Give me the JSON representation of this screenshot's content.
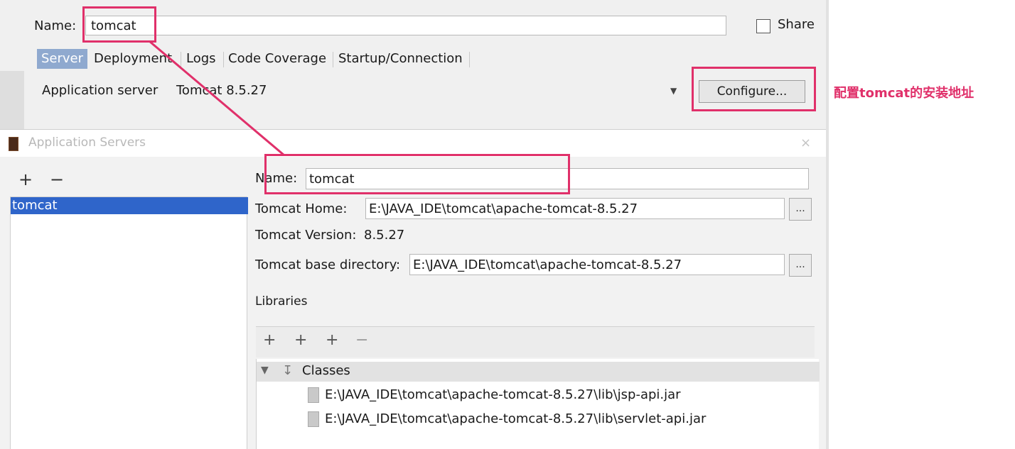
{
  "run_config": {
    "name_label": "Name:",
    "name_value": "tomcat",
    "share_label": "Share",
    "tabs": [
      "Server",
      "Deployment",
      "Logs",
      "Code Coverage",
      "Startup/Connection"
    ],
    "active_tab": "Server",
    "app_server_label": "Application server",
    "app_server_value": "Tomcat 8.5.27",
    "configure_button": "Configure..."
  },
  "annotation": {
    "text": "配置tomcat的安装地址",
    "color": "#e0306a"
  },
  "dialog": {
    "title": "Application Servers",
    "close_label": "×",
    "list_toolbar": {
      "add": "+",
      "remove": "−"
    },
    "servers": [
      "tomcat"
    ],
    "selected_server": "tomcat",
    "name_label": "Name:",
    "name_value": "tomcat",
    "tomcat_home_label": "Tomcat Home:",
    "tomcat_home_value": "E:\\JAVA_IDE\\tomcat\\apache-tomcat-8.5.27",
    "tomcat_version_label": "Tomcat Version:",
    "tomcat_version_value": "8.5.27",
    "base_dir_label": "Tomcat base directory:",
    "base_dir_value": "E:\\JAVA_IDE\\tomcat\\apache-tomcat-8.5.27",
    "browse_label": "...",
    "libraries_label": "Libraries",
    "libraries_toolbar": [
      "+",
      "+",
      "+",
      "−"
    ],
    "tree": {
      "group_label": "Classes",
      "items": [
        "E:\\JAVA_IDE\\tomcat\\apache-tomcat-8.5.27\\lib\\jsp-api.jar",
        "E:\\JAVA_IDE\\tomcat\\apache-tomcat-8.5.27\\lib\\servlet-api.jar"
      ]
    }
  },
  "colors": {
    "highlight_box": "#e0306a",
    "selection": "#2f65ca",
    "active_tab": "#8fa9cf"
  }
}
